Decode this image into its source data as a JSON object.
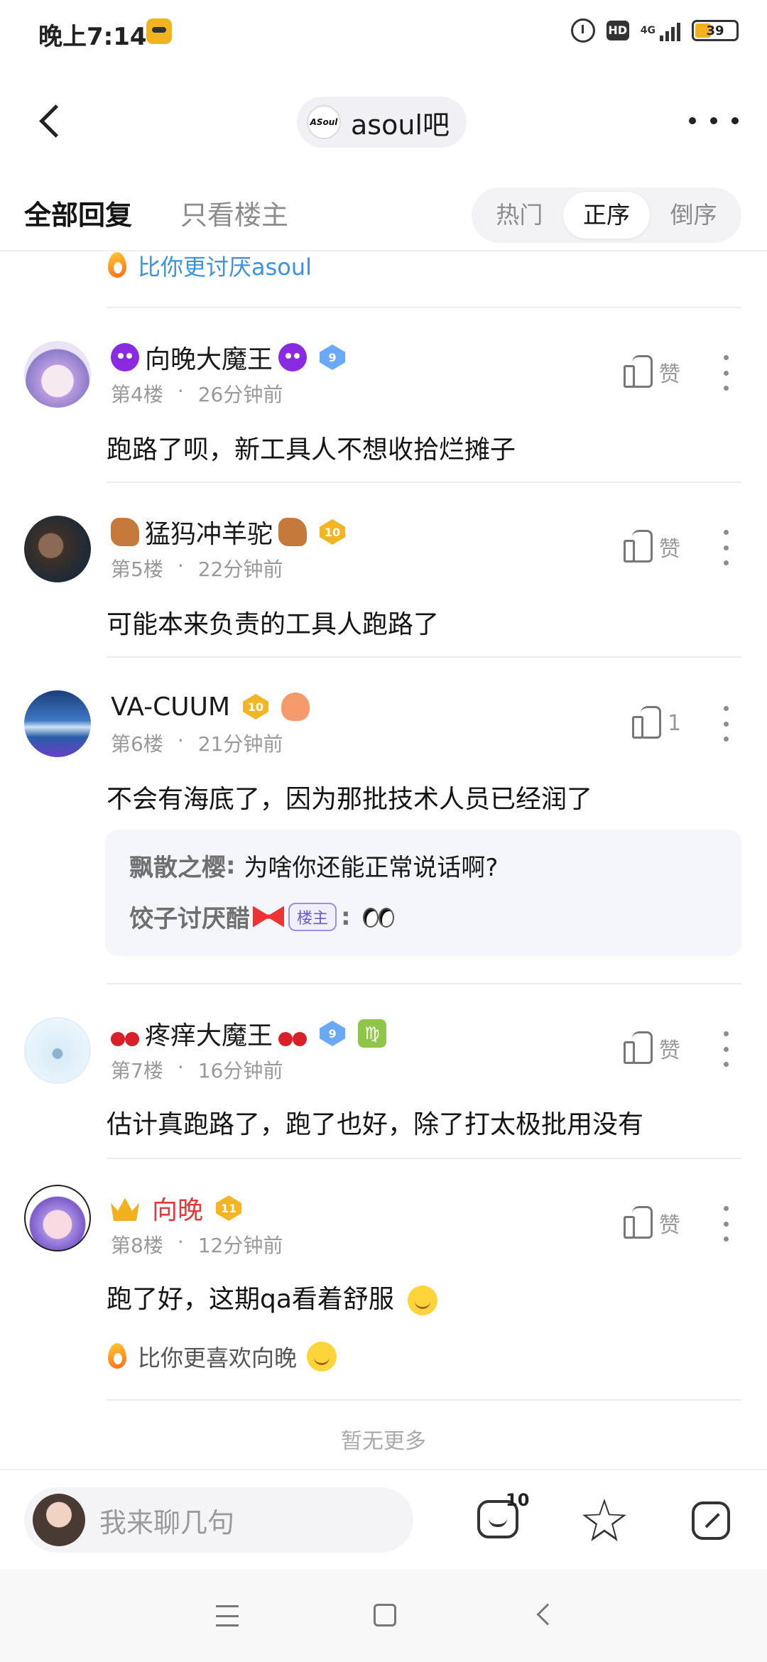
{
  "status_bar": {
    "time": "晚上7:14",
    "network": "4G",
    "battery": "39"
  },
  "header": {
    "forum_avatar_text": "ASoul",
    "forum_name": "asoul吧"
  },
  "tabs": {
    "all_replies": "全部回复",
    "owner_only": "只看楼主",
    "sort": [
      "热门",
      "正序",
      "倒序"
    ],
    "active_sort": "正序"
  },
  "top_tail": "比你更讨厌asoul",
  "replies": [
    {
      "username": "向晚大魔王",
      "level": "9",
      "floor": "第4楼",
      "time": "26分钟前",
      "likes": "赞",
      "text": "跑路了呗，新工具人不想收拾烂摊子"
    },
    {
      "username": "猛犸冲羊驼",
      "level": "10",
      "floor": "第5楼",
      "time": "22分钟前",
      "likes": "赞",
      "text": "可能本来负责的工具人跑路了"
    },
    {
      "username": "VA-CUUM",
      "level": "10",
      "floor": "第6楼",
      "time": "21分钟前",
      "likes": "1",
      "text": "不会有海底了，因为那批技术人员已经润了",
      "sub_replies": [
        {
          "author": "飘散之樱",
          "text": "为啥你还能正常说话啊?"
        },
        {
          "author": "饺子讨厌醋",
          "tag": "楼主",
          "text": ""
        }
      ]
    },
    {
      "username": "疼痒大魔王",
      "level": "9",
      "floor": "第7楼",
      "time": "16分钟前",
      "likes": "赞",
      "text": "估计真跑路了，跑了也好，除了打太极批用没有"
    },
    {
      "username": "向晚",
      "level": "11",
      "floor": "第8楼",
      "time": "12分钟前",
      "likes": "赞",
      "text": "跑了好，这期qa看着舒服",
      "tail": "比你更喜欢向晚"
    }
  ],
  "no_more": "暂无更多",
  "bottom": {
    "placeholder": "我来聊几句",
    "comment_count": "10"
  },
  "colors": {
    "link_blue": "#3b93e0",
    "owner_tag": "#6a5acd",
    "vip_red": "#e23a3a"
  }
}
